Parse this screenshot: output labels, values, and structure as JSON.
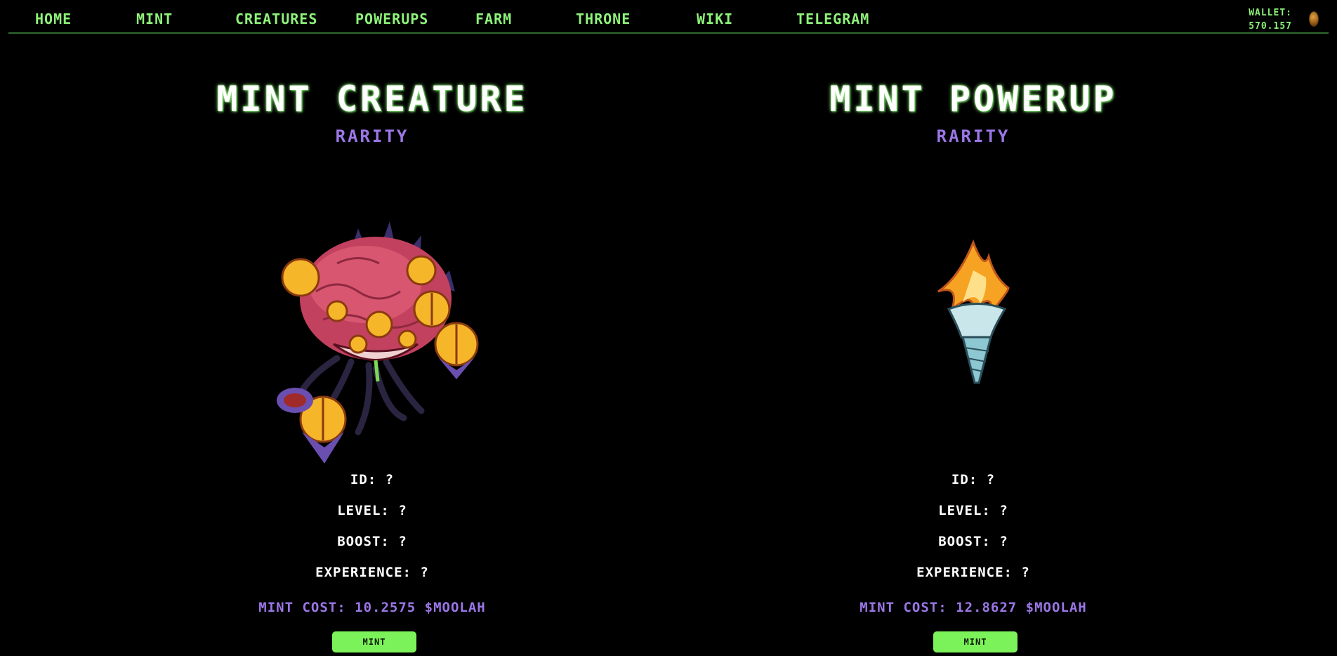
{
  "nav": {
    "items": [
      {
        "label": "HOME"
      },
      {
        "label": "MINT"
      },
      {
        "label": "CREATURES"
      },
      {
        "label": "POWERUPS"
      },
      {
        "label": "FARM"
      },
      {
        "label": "THRONE"
      },
      {
        "label": "WIKI"
      },
      {
        "label": "TELEGRAM"
      }
    ],
    "wallet_label": "WALLET:",
    "wallet_value": "570.157",
    "wallet_icon": "coin-icon"
  },
  "creature": {
    "title": "MINT CREATURE",
    "rarity": "RARITY",
    "image": "many-eyed-creature",
    "id_label": "ID:",
    "id_value": "?",
    "level_label": "LEVEL:",
    "level_value": "?",
    "boost_label": "BOOST:",
    "boost_value": "?",
    "experience_label": "EXPERIENCE:",
    "experience_value": "?",
    "cost_label": "MINT COST:",
    "cost_value": "10.2575 $MOOLAH",
    "button": "MINT"
  },
  "powerup": {
    "title": "MINT POWERUP",
    "rarity": "RARITY",
    "image": "flaming-torch",
    "id_label": "ID:",
    "id_value": "?",
    "level_label": "LEVEL:",
    "level_value": "?",
    "boost_label": "BOOST:",
    "boost_value": "?",
    "experience_label": "EXPERIENCE:",
    "experience_value": "?",
    "cost_label": "MINT COST:",
    "cost_value": "12.8627 $MOOLAH",
    "button": "MINT"
  },
  "colors": {
    "accent_green": "#8ef27a",
    "button_green": "#7cf25a",
    "rarity_purple": "#9b77e6",
    "background": "#000000"
  }
}
